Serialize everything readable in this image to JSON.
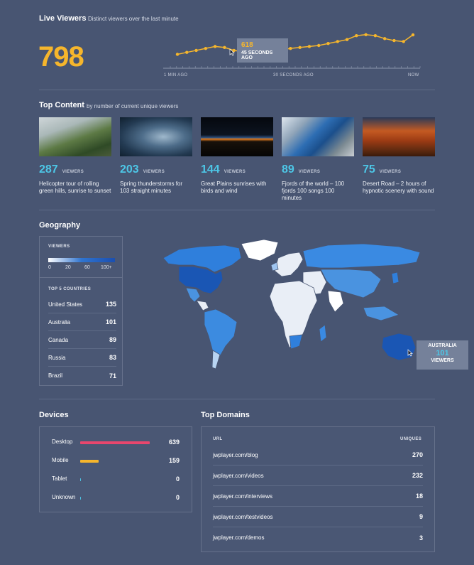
{
  "live": {
    "title": "Live Viewers",
    "subtitle": "Distinct viewers over the last minute",
    "count": "798",
    "axis": [
      "1 MIN AGO",
      "30 SECONDS AGO",
      "NOW"
    ],
    "tooltip_value": "618",
    "tooltip_label": "45 SECONDS AGO"
  },
  "chart_data": {
    "type": "line",
    "title": "",
    "xlabel": "",
    "ylabel": "",
    "x": [
      "1 MIN AGO",
      "",
      "",
      "",
      "",
      "",
      "",
      "",
      "",
      "",
      "",
      "",
      "",
      "",
      "",
      "",
      "",
      "",
      "",
      "",
      "",
      "",
      "",
      "30 SECONDS AGO",
      "",
      "",
      "",
      "",
      "",
      "",
      "",
      "",
      "",
      "",
      "",
      "",
      "",
      "",
      "",
      "NOW"
    ],
    "values": [
      600,
      620,
      640,
      660,
      680,
      670,
      640,
      625,
      618,
      600,
      625,
      645,
      660,
      670,
      680,
      690,
      710,
      730,
      750,
      790,
      800,
      790,
      760,
      740,
      730,
      798
    ],
    "color": "#f6b62c"
  },
  "top_content": {
    "title": "Top Content",
    "subtitle": "by number of current unique viewers",
    "viewers_label": "VIEWERS",
    "items": [
      {
        "count": "287",
        "title": "Helicopter tour of rolling green hills, sunrise to sunset"
      },
      {
        "count": "203",
        "title": "Spring thunderstorms for 103 straight minutes"
      },
      {
        "count": "144",
        "title": "Great Plains sunrises with birds and wind"
      },
      {
        "count": "89",
        "title": "Fjords of the world – 100 fjords 100 songs 100 minutes"
      },
      {
        "count": "75",
        "title": "Desert Road – 2 hours of hypnotic scenery with sound"
      }
    ]
  },
  "geography": {
    "title": "Geography",
    "legend_title": "VIEWERS",
    "legend_ticks": [
      "0",
      "20",
      "60",
      "100+"
    ],
    "top_title": "TOP 5 COUNTRIES",
    "countries": [
      {
        "name": "United States",
        "value": "135"
      },
      {
        "name": "Australia",
        "value": "101"
      },
      {
        "name": "Canada",
        "value": "89"
      },
      {
        "name": "Russia",
        "value": "83"
      },
      {
        "name": "Brazil",
        "value": "71"
      }
    ],
    "tooltip": {
      "country": "AUSTRALIA",
      "value": "101",
      "label": "VIEWERS"
    }
  },
  "devices": {
    "title": "Devices",
    "items": [
      {
        "name": "Desktop",
        "value": "639",
        "fraction": 1.0,
        "color": "#e8466d"
      },
      {
        "name": "Mobile",
        "value": "159",
        "fraction": 0.27,
        "color": "#f6b62c"
      },
      {
        "name": "Tablet",
        "value": "0",
        "fraction": 0.0,
        "color": "#4dc6e6"
      },
      {
        "name": "Unknown",
        "value": "0",
        "fraction": 0.0,
        "color": "#4dc6e6"
      }
    ]
  },
  "domains": {
    "title": "Top Domains",
    "col_url": "URL",
    "col_uniques": "UNIQUES",
    "rows": [
      {
        "url": "jwplayer.com/blog",
        "value": "270"
      },
      {
        "url": "jwplayer.com/videos",
        "value": "232"
      },
      {
        "url": "jwplayer.com/interviews",
        "value": "18"
      },
      {
        "url": "jwplayer.com/testvideos",
        "value": "9"
      },
      {
        "url": "jwplayer.com/demos",
        "value": "3"
      }
    ]
  }
}
